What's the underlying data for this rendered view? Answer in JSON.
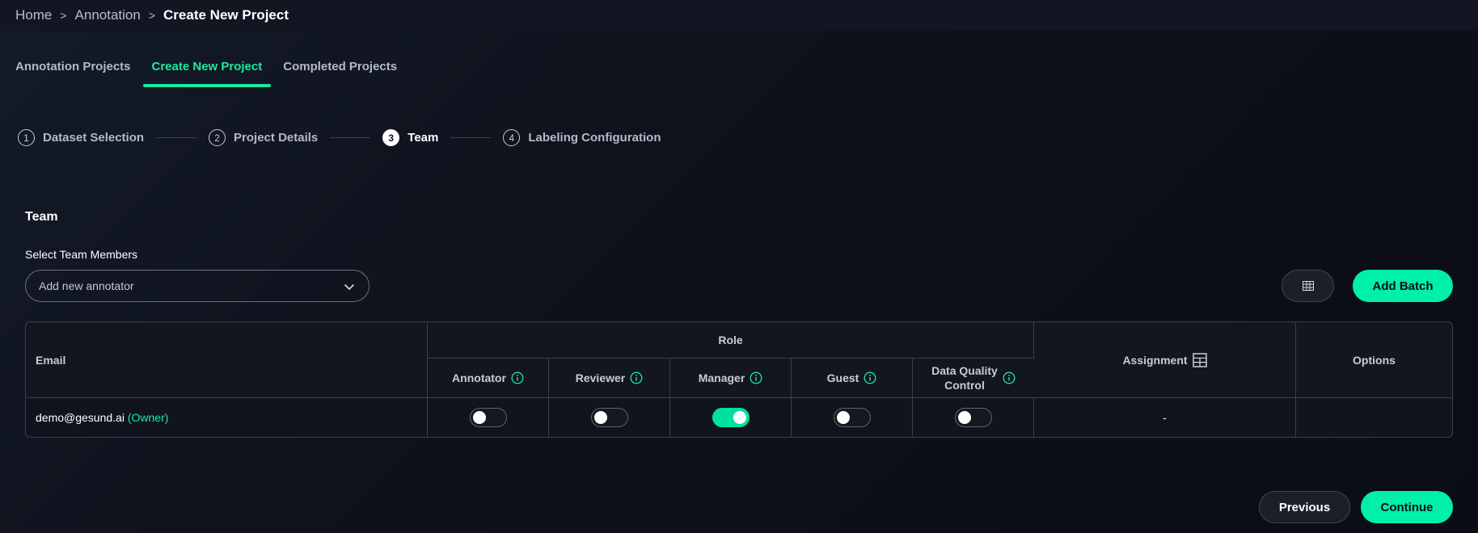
{
  "breadcrumb": {
    "items": [
      "Home",
      "Annotation"
    ],
    "separator": ">",
    "current": "Create New Project"
  },
  "tabs": [
    {
      "label": "Annotation Projects",
      "active": false
    },
    {
      "label": "Create New Project",
      "active": true
    },
    {
      "label": "Completed Projects",
      "active": false
    }
  ],
  "stepper": [
    {
      "num": "1",
      "label": "Dataset Selection",
      "active": false
    },
    {
      "num": "2",
      "label": "Project Details",
      "active": false
    },
    {
      "num": "3",
      "label": "Team",
      "active": true
    },
    {
      "num": "4",
      "label": "Labeling Configuration",
      "active": false
    }
  ],
  "team": {
    "title": "Team",
    "select_label": "Select Team Members",
    "select_placeholder": "Add new annotator",
    "add_batch_label": "Add Batch"
  },
  "table": {
    "headers": {
      "email": "Email",
      "role": "Role",
      "annotator": "Annotator",
      "reviewer": "Reviewer",
      "manager": "Manager",
      "guest": "Guest",
      "dq_line1": "Data Quality",
      "dq_line2": "Control",
      "assignment": "Assignment",
      "options": "Options"
    },
    "rows": [
      {
        "email": "demo@gesund.ai",
        "owner_tag": "(Owner)",
        "annotator": false,
        "reviewer": false,
        "manager": true,
        "guest": false,
        "dq": false,
        "assignment": "-"
      }
    ]
  },
  "footer": {
    "previous_label": "Previous",
    "continue_label": "Continue"
  },
  "colors": {
    "accent": "#00f0a8",
    "background": "#0d111b"
  },
  "icons": {
    "chevron": "chevron-down-icon",
    "info": "info-icon",
    "table": "table-grid-icon"
  }
}
